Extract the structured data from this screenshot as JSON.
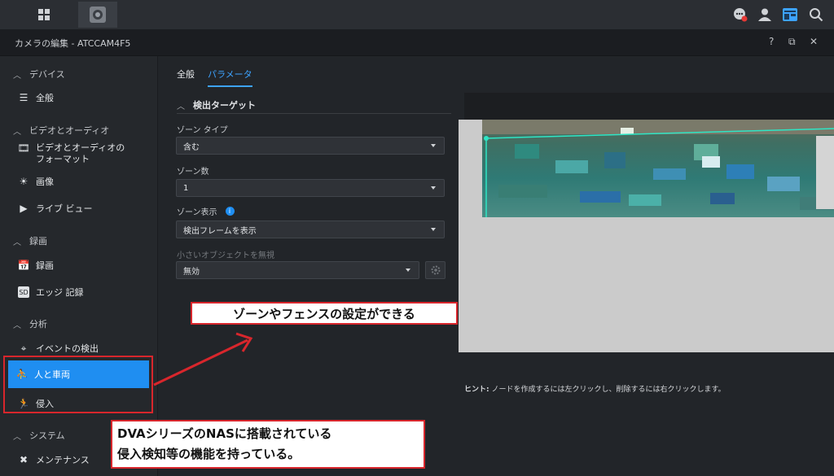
{
  "window": {
    "title": "カメラの編集 - ATCCAM4F5",
    "help": "?",
    "restore": "⧉",
    "close": "✕"
  },
  "topbar": {
    "apps_icon": "grid-icon",
    "camera_tab_icon": "camera-icon",
    "chat_icon": "chat-icon",
    "user_icon": "user-icon",
    "panel_icon": "panel-icon",
    "search_icon": "search-icon"
  },
  "sidebar": {
    "sections": [
      {
        "label": "デバイス",
        "items": [
          {
            "label": "全般",
            "icon": "list-icon"
          }
        ]
      },
      {
        "label": "ビデオとオーディオ",
        "items": [
          {
            "label": "ビデオとオーディオのフォーマット",
            "icon": "film-icon"
          },
          {
            "label": "画像",
            "icon": "brightness-icon"
          },
          {
            "label": "ライブ ビュー",
            "icon": "play-icon"
          }
        ]
      },
      {
        "label": "録画",
        "items": [
          {
            "label": "録画",
            "icon": "calendar-icon"
          },
          {
            "label": "エッジ 記録",
            "icon": "sd-card-icon"
          }
        ]
      },
      {
        "label": "分析",
        "items": [
          {
            "label": "イベントの検出",
            "icon": "crosshair-icon"
          },
          {
            "label": "人と車両",
            "icon": "person-vehicle-icon"
          },
          {
            "label": "侵入",
            "icon": "running-person-icon"
          }
        ]
      },
      {
        "label": "システム",
        "items": [
          {
            "label": "メンテナンス",
            "icon": "tools-icon"
          }
        ]
      }
    ]
  },
  "tabs": [
    "全般",
    "パラメータ"
  ],
  "active_tab": "パラメータ",
  "detection": {
    "group_title": "検出ターゲット",
    "zone_type_label": "ゾーン タイプ",
    "zone_type_value": "含む",
    "zone_count_label": "ゾーン数",
    "zone_count_value": "1",
    "zone_display_label": "ゾーン表示",
    "zone_display_value": "検出フレームを表示",
    "small_object_label": "小さいオブジェクトを無視",
    "small_object_value": "無効"
  },
  "hint": {
    "prefix": "ヒント:",
    "text": "ノードを作成するには左クリックし、削除するには右クリックします。"
  },
  "annotations": {
    "callout_zone": "ゾーンやフェンスの設定ができる",
    "callout_nas_line1": "DVAシリーズのNASに搭載されている",
    "callout_nas_line2": "侵入検知等の機能を持っている。"
  },
  "colors": {
    "accent": "#1f8ef1",
    "annotation_red": "#d8262c",
    "zone_line": "#2ee6c5"
  }
}
